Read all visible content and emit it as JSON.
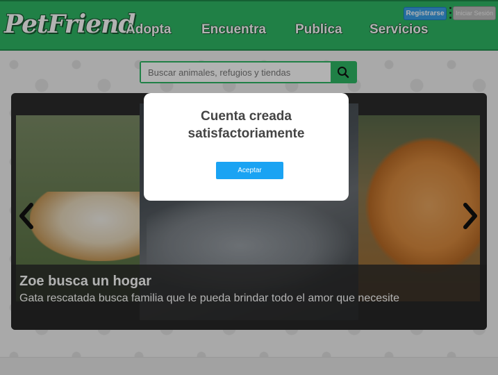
{
  "header": {
    "logo": "PetFriend",
    "nav": [
      "Adopta",
      "Encuentra",
      "Publica",
      "Servicios"
    ],
    "register_label": "Registrarse",
    "login_label": "Iniciar Sesión"
  },
  "search": {
    "placeholder": "Buscar animales, refugios y tiendas",
    "icon": "search-icon"
  },
  "carousel": {
    "caption_title": "Zoe busca un hogar",
    "caption_text": "Gata rescatada busca familia que le pueda brindar todo el amor que necesite",
    "prev_icon": "chevron-left-icon",
    "next_icon": "chevron-right-icon"
  },
  "modal": {
    "title": "Cuenta creada satisfactoriamente",
    "button_label": "Aceptar"
  },
  "colors": {
    "header_green": "#2fb865",
    "register_blue": "#3aa0e8",
    "accept_blue": "#1aa3f3"
  }
}
